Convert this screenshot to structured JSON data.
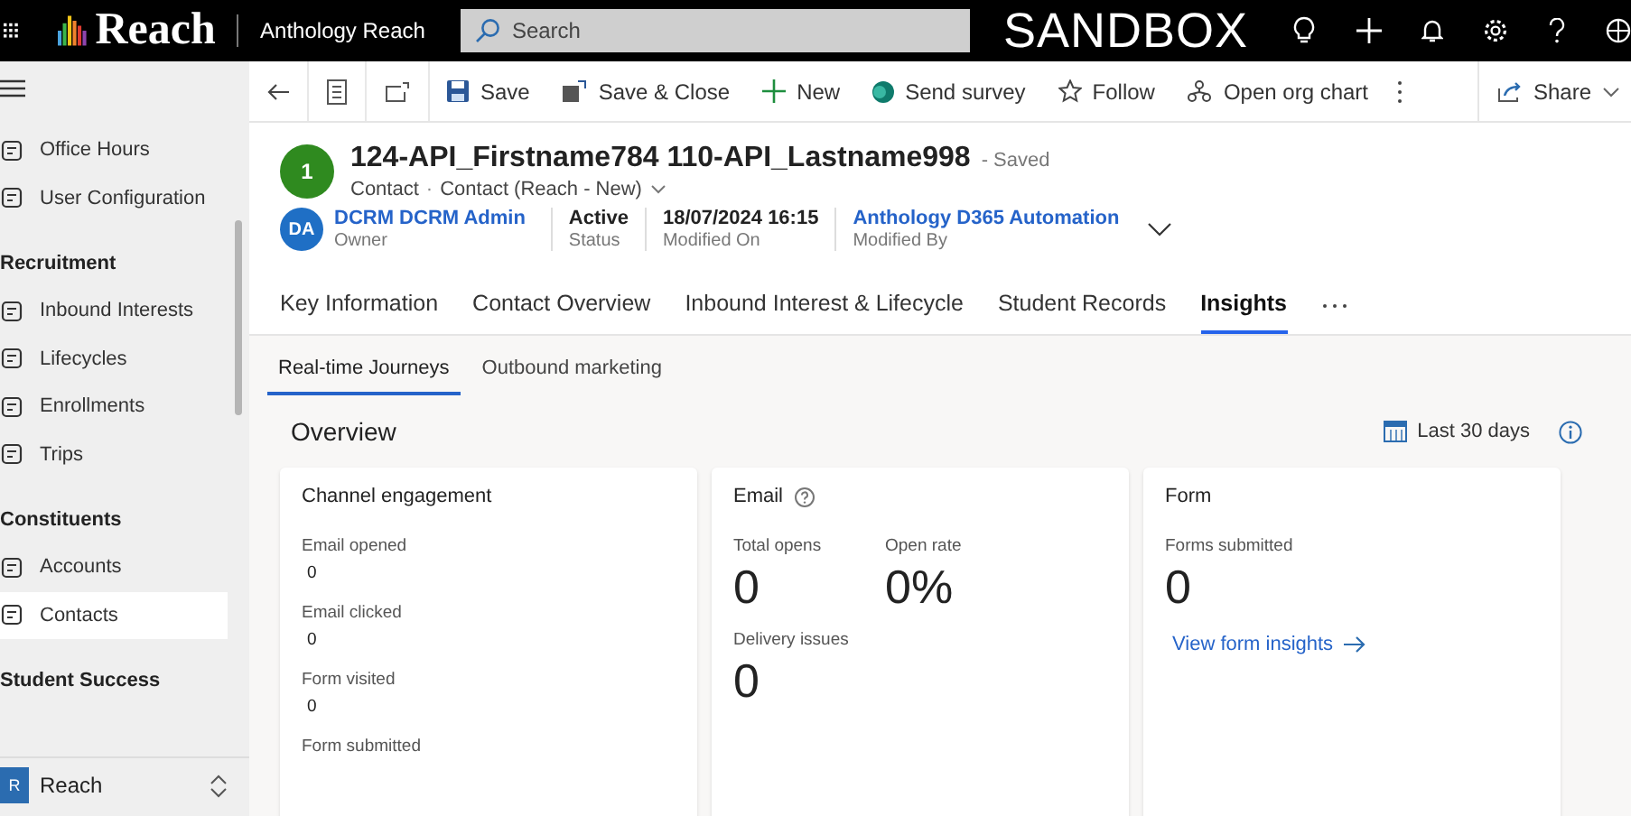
{
  "topbar": {
    "app_name": "Reach",
    "environment": "Anthology Reach",
    "search": {
      "placeholder": "Search"
    },
    "banner": "SANDBOX"
  },
  "sidebar": {
    "items": [
      {
        "kind": "item",
        "label": "Office Hours",
        "selected": false
      },
      {
        "kind": "item",
        "label": "User Configuration",
        "selected": false
      },
      {
        "kind": "heading",
        "label": "Recruitment"
      },
      {
        "kind": "item",
        "label": "Inbound Interests",
        "selected": false
      },
      {
        "kind": "item",
        "label": "Lifecycles",
        "selected": false
      },
      {
        "kind": "item",
        "label": "Enrollments",
        "selected": false
      },
      {
        "kind": "item",
        "label": "Trips",
        "selected": false
      },
      {
        "kind": "heading",
        "label": "Constituents"
      },
      {
        "kind": "item",
        "label": "Accounts",
        "selected": false
      },
      {
        "kind": "item",
        "label": "Contacts",
        "selected": true
      },
      {
        "kind": "heading",
        "label": "Student Success"
      }
    ],
    "area": {
      "badge": "R",
      "label": "Reach"
    }
  },
  "command_bar": {
    "buttons": [
      {
        "label": "Save"
      },
      {
        "label": "Save & Close"
      },
      {
        "label": "New"
      },
      {
        "label": "Send survey"
      },
      {
        "label": "Follow"
      },
      {
        "label": "Open org chart"
      }
    ],
    "share": "Share"
  },
  "record": {
    "avatar": "1",
    "title": "124-API_Firstname784 110-API_Lastname998",
    "save_state": "- Saved",
    "entity": "Contact",
    "separator": "·",
    "form": "Contact (Reach - New)",
    "fields": [
      {
        "kind": "owner",
        "initials": "DA",
        "value": "DCRM DCRM Admin",
        "label": "Owner"
      },
      {
        "kind": "plain",
        "value": "Active",
        "label": "Status"
      },
      {
        "kind": "plain",
        "value": "18/07/2024 16:15",
        "label": "Modified On"
      },
      {
        "kind": "link",
        "value": "Anthology D365 Automation",
        "label": "Modified By"
      }
    ]
  },
  "tabs": [
    {
      "label": "Key Information",
      "selected": false
    },
    {
      "label": "Contact Overview",
      "selected": false
    },
    {
      "label": "Inbound Interest & Lifecycle",
      "selected": false
    },
    {
      "label": "Student Records",
      "selected": false
    },
    {
      "label": "Insights",
      "selected": true
    }
  ],
  "subtabs": [
    {
      "label": "Real-time Journeys",
      "selected": true
    },
    {
      "label": "Outbound marketing",
      "selected": false
    }
  ],
  "overview": {
    "title": "Overview",
    "date_range": "Last 30 days"
  },
  "cards": [
    {
      "kind": "list",
      "title": "Channel engagement",
      "metrics": [
        {
          "label": "Email opened",
          "value": "0"
        },
        {
          "label": "Email clicked",
          "value": "0"
        },
        {
          "label": "Form visited",
          "value": "0"
        },
        {
          "label": "Form submitted"
        }
      ]
    },
    {
      "kind": "big",
      "title": "Email",
      "help": true,
      "metrics": [
        {
          "label": "Total opens",
          "value": "0"
        },
        {
          "label": "Open rate",
          "value": "0%"
        },
        {
          "label": "Delivery issues",
          "value": "0"
        }
      ]
    },
    {
      "kind": "big",
      "title": "Form",
      "metrics": [
        {
          "label": "Forms submitted",
          "value": "0"
        }
      ],
      "link": "View form insights"
    }
  ]
}
